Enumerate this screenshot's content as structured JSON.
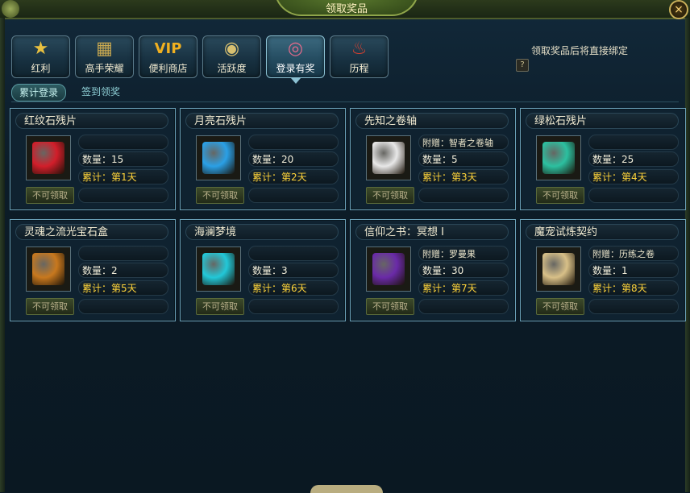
{
  "window": {
    "title": "领取奖品",
    "close_symbol": "×"
  },
  "tabs": [
    {
      "label": "红利",
      "icon": "star-arrow-icon",
      "glyph": "★"
    },
    {
      "label": "高手荣耀",
      "icon": "trophy-box-icon",
      "glyph": "▦"
    },
    {
      "label": "便利商店",
      "icon": "vip-icon",
      "glyph": "VIP"
    },
    {
      "label": "活跃度",
      "icon": "eye-icon",
      "glyph": "◉"
    },
    {
      "label": "登录有奖",
      "icon": "ring-icon",
      "glyph": "◎"
    },
    {
      "label": "历程",
      "icon": "potion-icon",
      "glyph": "♨"
    }
  ],
  "active_tab": 4,
  "notice": "领取奖品后将直接绑定",
  "help_symbol": "?",
  "subtabs": [
    "累计登录",
    "签到领奖"
  ],
  "claim_label": "不可领取",
  "rewards": [
    {
      "name": "红纹石残片",
      "icon": "red-gem-icon",
      "gift": "",
      "qty": "数量：15",
      "day": "累计：第1天",
      "color": "#d21e2a"
    },
    {
      "name": "月亮石残片",
      "icon": "blue-gem-icon",
      "gift": "",
      "qty": "数量：20",
      "day": "累计：第2天",
      "color": "#2aa0e6"
    },
    {
      "name": "先知之卷轴",
      "icon": "scroll-icon",
      "gift": "附赠：智者之卷轴",
      "qty": "数量：5",
      "day": "累计：第3天",
      "color": "#e8e8e8"
    },
    {
      "name": "绿松石残片",
      "icon": "green-gem-icon",
      "gift": "",
      "qty": "数量：25",
      "day": "累计：第4天",
      "color": "#2cc0a0"
    },
    {
      "name": "灵魂之流光宝石盒",
      "icon": "treasure-box-icon",
      "gift": "",
      "qty": "数量：2",
      "day": "累计：第5天",
      "color": "#c8781e"
    },
    {
      "name": "海澜梦境",
      "icon": "cocktail-glass-icon",
      "gift": "",
      "qty": "数量：3",
      "day": "累计：第6天",
      "color": "#22c8d8"
    },
    {
      "name": "信仰之书：冥想 Ⅰ",
      "icon": "purple-book-icon",
      "gift": "附赠：罗曼果",
      "qty": "数量：30",
      "day": "累计：第7天",
      "color": "#6a2aa8"
    },
    {
      "name": "魔宠试炼契约",
      "icon": "parchment-icon",
      "gift": "附赠：历练之卷",
      "qty": "数量：1",
      "day": "累计：第8天",
      "color": "#d8c088"
    }
  ]
}
